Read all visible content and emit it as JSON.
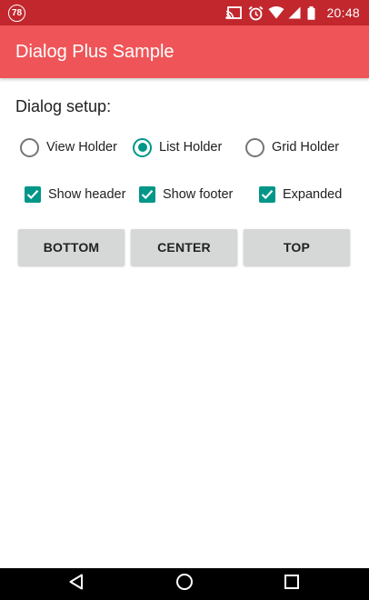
{
  "status_bar": {
    "notification_badge": "78",
    "icons": [
      "cast-icon",
      "alarm-icon",
      "wifi-icon",
      "signal-icon",
      "battery-icon"
    ],
    "time": "20:48"
  },
  "app_bar": {
    "title": "Dialog Plus Sample",
    "color": "#ef5558"
  },
  "dialog_setup": {
    "label": "Dialog setup:",
    "holders": [
      {
        "label": "View Holder",
        "checked": false
      },
      {
        "label": "List Holder",
        "checked": true
      },
      {
        "label": "Grid Holder",
        "checked": false
      }
    ],
    "options": [
      {
        "label": "Show header",
        "checked": true
      },
      {
        "label": "Show footer",
        "checked": true
      },
      {
        "label": "Expanded",
        "checked": true
      }
    ],
    "gravity_buttons": [
      {
        "label": "BOTTOM"
      },
      {
        "label": "CENTER"
      },
      {
        "label": "TOP"
      }
    ],
    "accent_color": "#009688"
  },
  "nav_bar": {
    "icons": [
      "back-icon",
      "home-icon",
      "recents-icon"
    ]
  }
}
